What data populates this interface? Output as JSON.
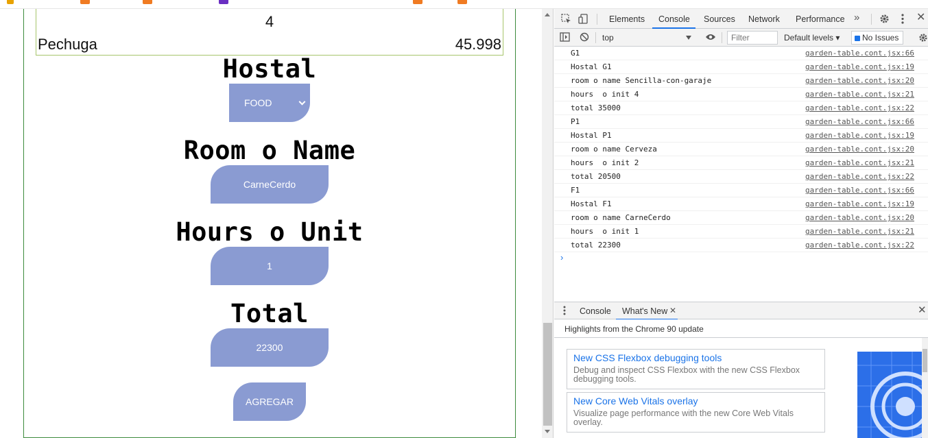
{
  "colors": {
    "pill": "#8a9bd2",
    "accent": "#1a73e8",
    "frame": "#3c8a3c"
  },
  "page": {
    "order": {
      "quantity": "4",
      "item_name": "Pechuga",
      "item_price": "45.998"
    },
    "hostal": {
      "label": "Hostal",
      "selected": "FOOD"
    },
    "room": {
      "label": "Room o Name",
      "value": "CarneCerdo"
    },
    "hours": {
      "label": "Hours o Unit",
      "value": "1"
    },
    "total": {
      "label": "Total",
      "value": "22300"
    },
    "add_button": "AGREGAR"
  },
  "devtools": {
    "tabs": [
      "Elements",
      "Console",
      "Sources",
      "Network",
      "Performance"
    ],
    "active_tab": "Console",
    "more_tabs_icon": "chevron-double-right-icon",
    "toolbar": {
      "context": "top",
      "filter_placeholder": "Filter",
      "levels": "Default levels",
      "issues": "No Issues"
    },
    "logs": [
      {
        "msg": "G1",
        "src": "garden-table.cont.jsx:66"
      },
      {
        "msg": "Hostal G1",
        "src": "garden-table.cont.jsx:19"
      },
      {
        "msg": "room o name Sencilla-con-garaje",
        "src": "garden-table.cont.jsx:20"
      },
      {
        "msg": "hours  o init 4",
        "src": "garden-table.cont.jsx:21"
      },
      {
        "msg": "total 35000",
        "src": "garden-table.cont.jsx:22"
      },
      {
        "msg": "P1",
        "src": "garden-table.cont.jsx:66"
      },
      {
        "msg": "Hostal P1",
        "src": "garden-table.cont.jsx:19"
      },
      {
        "msg": "room o name Cerveza",
        "src": "garden-table.cont.jsx:20"
      },
      {
        "msg": "hours  o init 2",
        "src": "garden-table.cont.jsx:21"
      },
      {
        "msg": "total 20500",
        "src": "garden-table.cont.jsx:22"
      },
      {
        "msg": "F1",
        "src": "garden-table.cont.jsx:66"
      },
      {
        "msg": "Hostal F1",
        "src": "garden-table.cont.jsx:19"
      },
      {
        "msg": "room o name CarneCerdo",
        "src": "garden-table.cont.jsx:20"
      },
      {
        "msg": "hours  o init 1",
        "src": "garden-table.cont.jsx:21"
      },
      {
        "msg": "total 22300",
        "src": "garden-table.cont.jsx:22"
      }
    ],
    "drawer": {
      "tabs": [
        "Console",
        "What's New"
      ],
      "active_tab": "What's New",
      "subtitle": "Highlights from the Chrome 90 update",
      "cards": [
        {
          "title": "New CSS Flexbox debugging tools",
          "desc": "Debug and inspect CSS Flexbox with the new CSS Flexbox debugging tools."
        },
        {
          "title": "New Core Web Vitals overlay",
          "desc": "Visualize page performance with the new Core Web Vitals overlay."
        }
      ]
    }
  }
}
